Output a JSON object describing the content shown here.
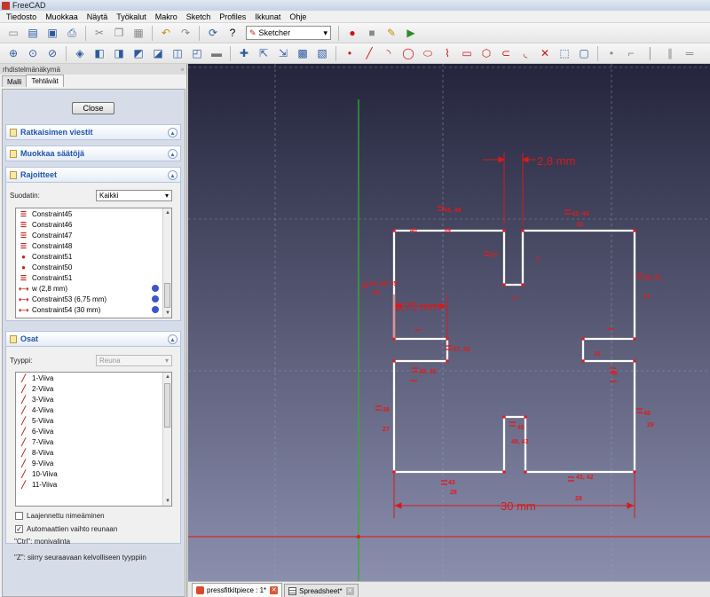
{
  "window": {
    "title": "FreeCAD"
  },
  "menu": [
    "Tiedosto",
    "Muokkaa",
    "Näytä",
    "Työkalut",
    "Makro",
    "Sketch",
    "Profiles",
    "Ikkunat",
    "Ohje"
  ],
  "toolbar": {
    "workbench": "Sketcher"
  },
  "combo": {
    "title": "rhdistelmänäkymä",
    "tabs": [
      "Malli",
      "Tehtävät"
    ],
    "close_label": "Close",
    "panels": {
      "solver": "Ratkaisimen viestit",
      "edit": "Muokkaa säätöjä",
      "constraints": "Rajoitteet",
      "elements": "Osat"
    },
    "constraints": {
      "filter_label": "Suodatin:",
      "filter_value": "Kaikki",
      "items": [
        {
          "label": "Constraint45",
          "icon": "hv"
        },
        {
          "label": "Constraint46",
          "icon": "hv"
        },
        {
          "label": "Constraint47",
          "icon": "hv"
        },
        {
          "label": "Constraint48",
          "icon": "hv"
        },
        {
          "label": "Constraint51",
          "icon": "pt"
        },
        {
          "label": "Constraint50",
          "icon": "pt"
        },
        {
          "label": "Constraint51",
          "icon": "hv"
        },
        {
          "label": "w (2,8 mm)",
          "icon": "dim",
          "badge": true
        },
        {
          "label": "Constraint53 (6,75 mm)",
          "icon": "dim",
          "badge": true
        },
        {
          "label": "Constraint54 (30 mm)",
          "icon": "dim",
          "badge": true
        }
      ]
    },
    "elements": {
      "type_label": "Tyyppi:",
      "type_value": "Reuna",
      "items": [
        "1-Viiva",
        "2-Viiva",
        "3-Viiva",
        "4-Viiva",
        "5-Viiva",
        "6-Viiva",
        "7-Viiva",
        "8-Viiva",
        "9-Viiva",
        "10-Viiva",
        "11-Viiva"
      ],
      "extended_naming": "Laajennettu nimeäminen",
      "auto_switch": "Automaattien vaihto reunaan",
      "hint1": "\"Ctrl\": monivalinta",
      "hint2": "\"Z\": siirry seuraavaan kelvolliseen tyyppiin"
    }
  },
  "sketch": {
    "dims": {
      "w": "2,8 mm",
      "d675": "6,75 mm",
      "d30": "30 mm"
    },
    "labels": [
      "53, 49",
      "43, 44",
      "47",
      "44, 39, 35",
      "45",
      "39",
      "33",
      "48, 35",
      "37",
      "57, 45",
      "48, 46",
      "31",
      "46",
      "38",
      "45",
      "27",
      "48, 43",
      "48",
      "29",
      "43",
      "28",
      "43, 42",
      "28",
      "1",
      "40"
    ]
  },
  "doc_tabs": [
    {
      "label": "pressfitkitpiece : 1*",
      "active": true
    },
    {
      "label": "Spreadsheet*",
      "active": false
    }
  ]
}
